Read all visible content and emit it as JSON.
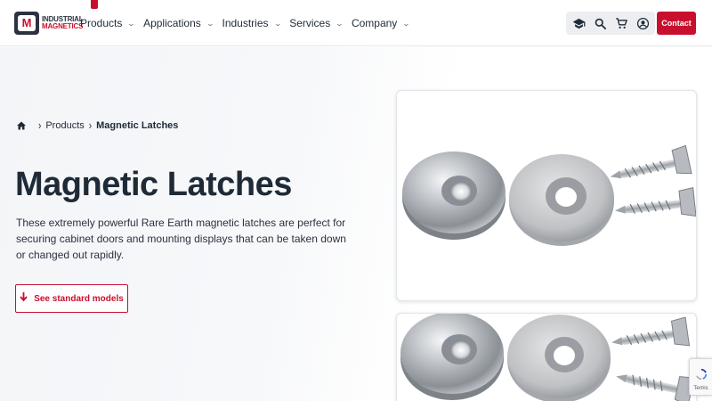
{
  "brand": {
    "line1": "INDUSTRIAL",
    "line2": "MAGNETICS",
    "logo_icon": "magnet-logo-icon",
    "accent_color": "#c8102e"
  },
  "nav": {
    "items": [
      {
        "label": "Products"
      },
      {
        "label": "Applications"
      },
      {
        "label": "Industries"
      },
      {
        "label": "Services"
      },
      {
        "label": "Company"
      }
    ],
    "chevron": "⌄"
  },
  "tools": {
    "icons": [
      "graduation-cap-icon",
      "search-icon",
      "cart-icon",
      "account-icon"
    ]
  },
  "contact": {
    "label": "Contact"
  },
  "breadcrumb": {
    "home_icon": "home-icon",
    "items": [
      "Products",
      "Magnetic Latches"
    ]
  },
  "hero": {
    "title": "Magnetic Latches",
    "description": "These extremely powerful Rare Earth magnetic latches are perfect for securing cabinet doors and mounting displays that can be taken down or changed out rapidly.",
    "button_label": "See standard models"
  },
  "recaptcha": {
    "text": "Terms"
  }
}
